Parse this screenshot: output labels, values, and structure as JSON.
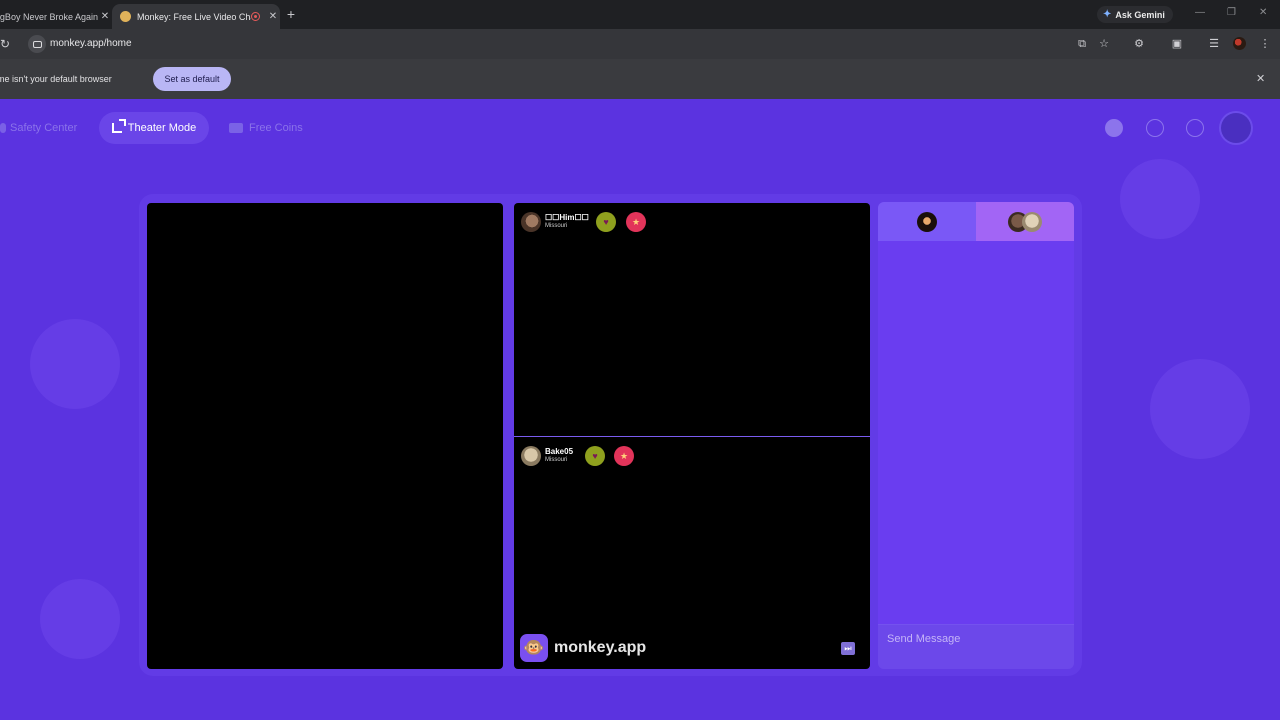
{
  "browser": {
    "tabs": [
      {
        "title": "NBA YoungBoy Never Broke Again",
        "active": false
      },
      {
        "title": "Monkey: Free Live Video Chat",
        "active": true
      }
    ],
    "new_tab_label": "+",
    "ask_gemini": "Ask Gemini",
    "url": "monkey.app/home",
    "info_bar": {
      "text": "Google Chrome isn't your default browser",
      "button": "Set as default"
    }
  },
  "nav": {
    "safety_center": "Safety Center",
    "theater_mode": "Theater Mode",
    "free_coins": "Free Coins"
  },
  "videos": [
    {
      "name": "☐☐Him☐☐",
      "location": "Missouri"
    },
    {
      "name": "Bake05",
      "location": "Missouri"
    }
  ],
  "brand": {
    "logo": "🐵",
    "text": "monkey.app"
  },
  "chat": {
    "placeholder": "Send Message"
  },
  "colors": {
    "page_bg": "#5b33e0",
    "panel": "#623be6",
    "accent": "#a265f5",
    "chrome_dark": "#1f2023"
  },
  "icons": {
    "reload": "reload-icon",
    "star": "bookmark-star-icon",
    "extensions": "extensions-icon",
    "heart": "heart-icon",
    "report": "report-icon",
    "skip": "skip-icon"
  }
}
